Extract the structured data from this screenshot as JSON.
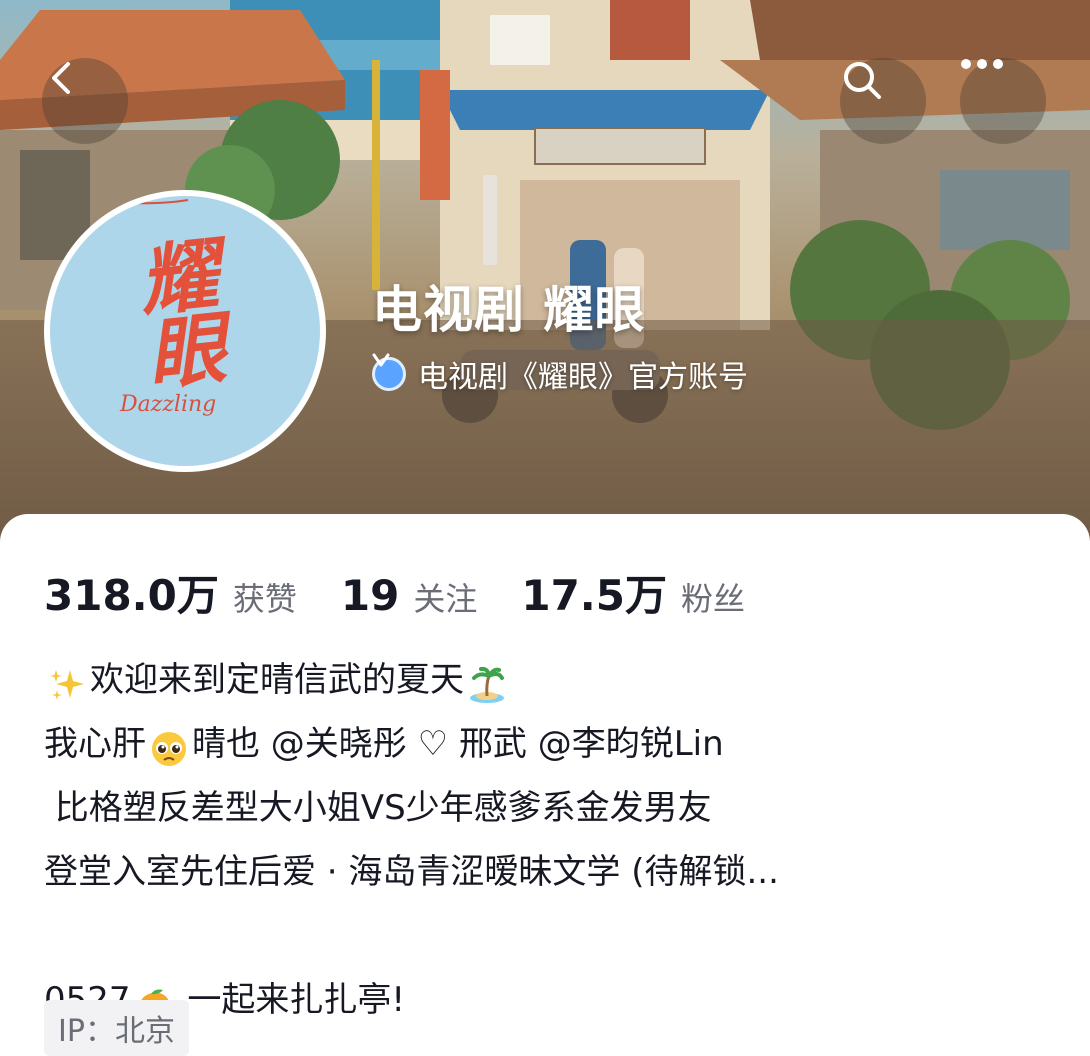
{
  "nav": {
    "back_icon": "chevron-left-icon",
    "search_icon": "search-icon",
    "more_icon": "more-horizontal-icon"
  },
  "avatar": {
    "brush_text": "耀眼",
    "script_text": "Dazzling",
    "background_color": "#aed6ea",
    "brush_color": "#e4513a"
  },
  "profile": {
    "name": "电视剧 耀眼",
    "verified_icon": "verified-badge-icon",
    "verified_color": "#5aa4ff",
    "verified_text": "电视剧《耀眼》官方账号"
  },
  "stats": [
    {
      "value": "318.0万",
      "label": "获赞"
    },
    {
      "value": "19",
      "label": "关注"
    },
    {
      "value": "17.5万",
      "label": "粉丝"
    }
  ],
  "bio": {
    "line1": {
      "emoji_start": "sparkles-emoji",
      "text": "欢迎来到定晴信武的夏天",
      "emoji_end": "desert-island-emoji"
    },
    "line2": {
      "text_a": "我心肝",
      "emoji": "pleading-face-emoji",
      "text_b": "晴也 @关晓彤 ♡ 邢武 @李昀锐Lin"
    },
    "line3": " 比格塑反差型大小姐VS少年感爹系金发男友",
    "line4": "登堂入室先住后爱 · 海岛青涩暧昧文学 (待解锁...",
    "line5": {
      "text_a": "0527",
      "emoji": "mango-emoji",
      "text_b": " 一起来扎扎亭!"
    }
  },
  "ip": "IP：北京"
}
